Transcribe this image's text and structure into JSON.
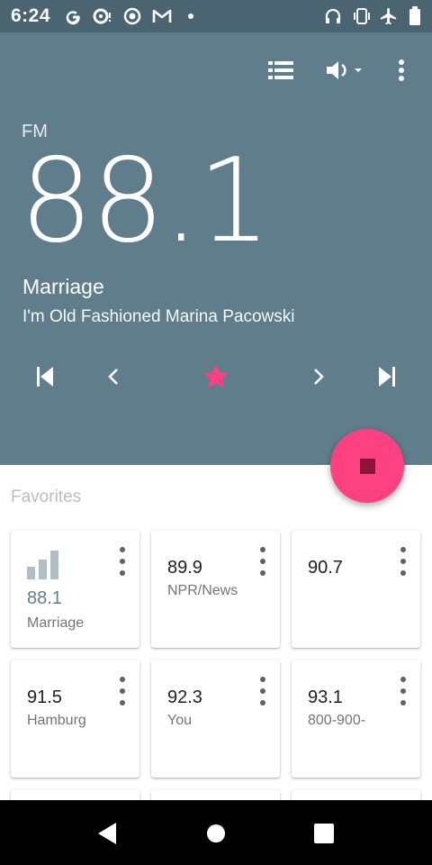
{
  "status": {
    "time": "6:24",
    "left_icons": [
      "google-icon",
      "camera-notification-icon",
      "target-icon",
      "gmail-icon",
      "dot-icon"
    ],
    "right_icons": [
      "headphones-icon",
      "vibrate-icon",
      "airplane-mode-icon",
      "battery-icon"
    ]
  },
  "toolbar": {
    "icons": [
      "station-list-icon",
      "speaker-output-icon",
      "overflow-menu-icon"
    ]
  },
  "player": {
    "band": "FM",
    "frequency": "88.1",
    "station": "Marriage",
    "now_playing": "I'm Old Fashioned Marina Pacowski"
  },
  "controls": [
    "skip-previous-icon",
    "seek-back-icon",
    "favorite-star-icon",
    "seek-forward-icon",
    "skip-next-icon"
  ],
  "favorites": {
    "title": "Favorites",
    "items": [
      {
        "frequency": "88.1",
        "name": "Marriage",
        "active": true
      },
      {
        "frequency": "89.9",
        "name": "NPR/News"
      },
      {
        "frequency": "90.7",
        "name": ""
      },
      {
        "frequency": "91.5",
        "name": "Hamburg"
      },
      {
        "frequency": "92.3",
        "name": "You"
      },
      {
        "frequency": "93.1",
        "name": "800-900-"
      }
    ]
  },
  "colors": {
    "header": "#607d8b",
    "statusbar": "#4a6472",
    "accent": "#ff4081",
    "star": "#ff4081"
  }
}
